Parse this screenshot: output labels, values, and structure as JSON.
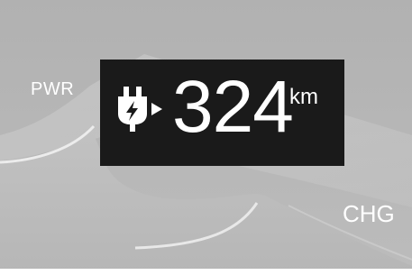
{
  "gauge": {
    "power_label": "PWR",
    "charge_label": "CHG"
  },
  "range_display": {
    "icon": "ev-plug-icon",
    "value": "324",
    "unit": "km"
  },
  "colors": {
    "background": "#b4b4b4",
    "display_box": "#1a1a1a",
    "text": "#ffffff"
  }
}
